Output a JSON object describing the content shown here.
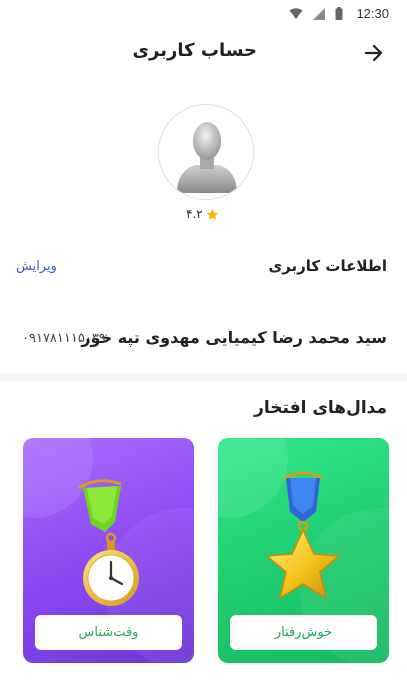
{
  "status_bar": {
    "time": "12:30"
  },
  "header": {
    "title": "حساب کاربری"
  },
  "profile": {
    "rating": "۴.۲"
  },
  "user_info": {
    "section_label": "اطلاعات کاربری",
    "edit_label": "ویرایش",
    "name": "سید محمد رضا کیمیایی مهدوی تپه خور",
    "phone": "۰۹۱۷۸۱۱۱۵۰۳۹"
  },
  "medals": {
    "title": "مدال‌های افتخار",
    "items": [
      {
        "label": "خوش‌رفتار",
        "color": "#1fcc70"
      },
      {
        "label": "وقت‌شناس",
        "color": "#8a48f0"
      }
    ]
  }
}
